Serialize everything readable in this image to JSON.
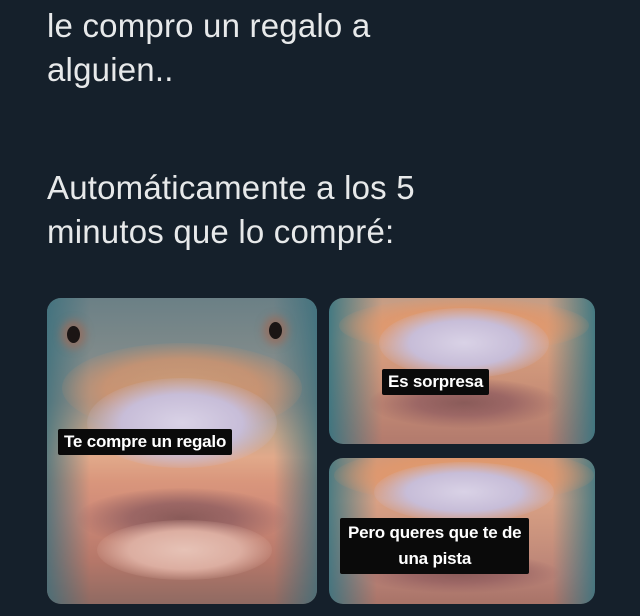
{
  "top_text": {
    "lines": [
      "le compro un regalo a",
      "alguien.."
    ]
  },
  "second_text": {
    "lines": [
      "Automáticamente a los 5",
      "minutos que lo compré:"
    ]
  },
  "panels": {
    "left": {
      "caption": "Te compre un regalo"
    },
    "top_right": {
      "caption": "Es sorpresa"
    },
    "bottom_right": {
      "caption_lines": [
        "Pero queres que te de",
        "una pista"
      ]
    }
  },
  "colors": {
    "background": "#15202b",
    "text": "#e7e9ea",
    "caption_bg": "#0a0a0a",
    "caption_text": "#ffffff"
  }
}
